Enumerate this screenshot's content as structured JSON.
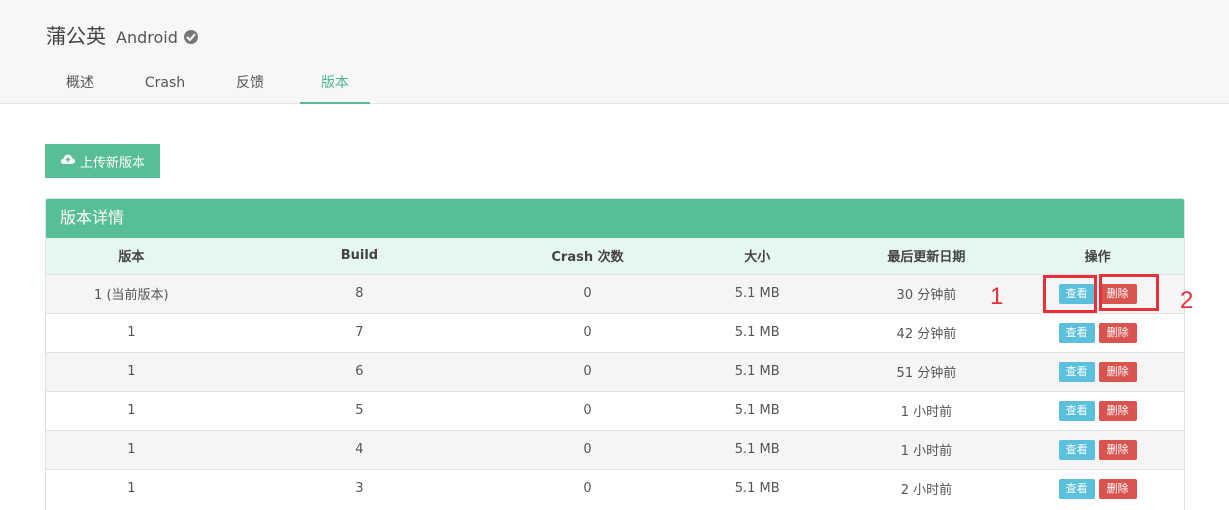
{
  "app": {
    "name": "蒲公英",
    "platform": "Android"
  },
  "tabs": [
    "概述",
    "Crash",
    "反馈",
    "版本"
  ],
  "active_tab": 3,
  "upload_button": "上传新版本",
  "panel_title": "版本详情",
  "columns": [
    "版本",
    "Build",
    "Crash 次数",
    "大小",
    "最后更新日期",
    "操作"
  ],
  "rows": [
    {
      "version": "1 (当前版本)",
      "build": "8",
      "crashes": "0",
      "size": "5.1 MB",
      "updated": "30 分钟前"
    },
    {
      "version": "1",
      "build": "7",
      "crashes": "0",
      "size": "5.1 MB",
      "updated": "42 分钟前"
    },
    {
      "version": "1",
      "build": "6",
      "crashes": "0",
      "size": "5.1 MB",
      "updated": "51 分钟前"
    },
    {
      "version": "1",
      "build": "5",
      "crashes": "0",
      "size": "5.1 MB",
      "updated": "1 小时前"
    },
    {
      "version": "1",
      "build": "4",
      "crashes": "0",
      "size": "5.1 MB",
      "updated": "1 小时前"
    },
    {
      "version": "1",
      "build": "3",
      "crashes": "0",
      "size": "5.1 MB",
      "updated": "2 小时前"
    }
  ],
  "actions": {
    "view": "查看",
    "delete": "删除"
  },
  "annotations": [
    "1",
    "2"
  ],
  "colors": {
    "accent": "#57be96",
    "view": "#5bc0de",
    "delete": "#d9534f",
    "annotation": "#e8303a"
  }
}
